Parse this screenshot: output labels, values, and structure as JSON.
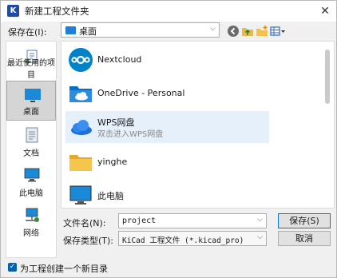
{
  "window": {
    "title": "新建工程文件夹",
    "app_icon_text": "K",
    "close_glyph": "✕"
  },
  "toolbar": {
    "save_in_label": "保存在(I):",
    "location_value": "桌面",
    "icons": [
      "back-icon",
      "up-folder-icon",
      "new-folder-icon",
      "view-menu-icon"
    ]
  },
  "places": [
    {
      "label": "最近使用的项目",
      "icon": "recent-icon",
      "selected": false
    },
    {
      "label": "桌面",
      "icon": "desktop-icon",
      "selected": true
    },
    {
      "label": "文档",
      "icon": "documents-icon",
      "selected": false
    },
    {
      "label": "此电脑",
      "icon": "computer-icon",
      "selected": false
    },
    {
      "label": "网络",
      "icon": "network-icon",
      "selected": false
    }
  ],
  "files": [
    {
      "name": "Nextcloud",
      "icon": "nextcloud-icon"
    },
    {
      "name": "OneDrive - Personal",
      "icon": "onedrive-folder-icon"
    },
    {
      "name": "WPS网盘",
      "sub": "双击进入WPS网盘",
      "icon": "wps-cloud-icon"
    },
    {
      "name": "yinghe",
      "icon": "folder-icon"
    },
    {
      "name": "此电脑",
      "icon": "computer-icon"
    }
  ],
  "form": {
    "filename_label": "文件名(N):",
    "filename_value": "project",
    "filetype_label": "保存类型(T):",
    "filetype_value": "KiCad 工程文件 (*.kicad_pro)"
  },
  "buttons": {
    "save": "保存(S)",
    "cancel": "取消"
  },
  "checkbox": {
    "label": "为工程创建一个新目录",
    "checked": true
  },
  "colors": {
    "accent": "#0078d7",
    "selected_bg": "#d5d5d5",
    "highlight_bg": "#e6f0fb"
  }
}
